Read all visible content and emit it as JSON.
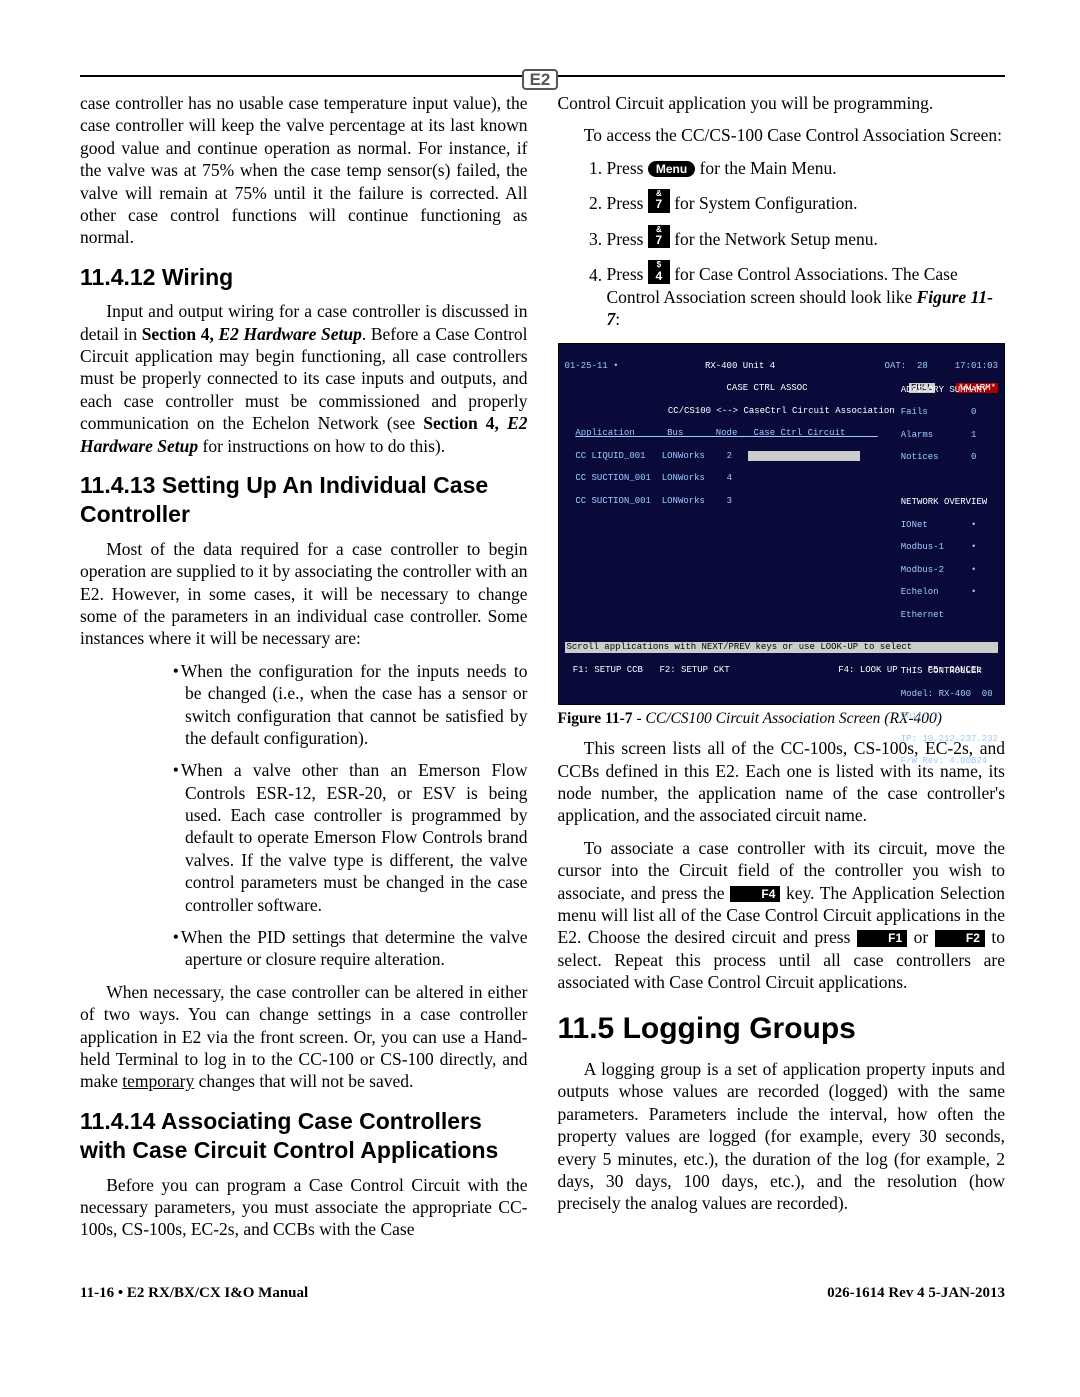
{
  "header_logo": "E2",
  "left": {
    "p1": "case controller has no usable case temperature input value), the case controller will keep the valve percentage at its last known good value and continue operation as normal. For instance, if the valve was at 75% when the case temp sensor(s) failed, the valve will remain at 75% until it the failure is corrected. All other case control functions will continue functioning as normal.",
    "h_wiring": "11.4.12 Wiring",
    "p_wiring_a": "Input and output wiring for a case controller is discussed in detail in ",
    "p_wiring_bold1": "Section 4, ",
    "p_wiring_ital1": "E2 Hardware Setup",
    "p_wiring_b": ". Before a Case Control Circuit application may begin functioning, all case controllers must be properly connected to its case inputs and outputs, and each case controller must be commissioned and properly communication on the Echelon Network (see ",
    "p_wiring_bold2": "Section 4, ",
    "p_wiring_ital2": "E2 Hardware Setup",
    "p_wiring_c": " for instructions on how to do this).",
    "h_setup": "11.4.13 Setting Up An Individual Case Controller",
    "p_setup": "Most of the data required for a case controller to begin operation are supplied to it by associating the controller with an E2. However, in some cases, it will be necessary to change some of the parameters in an individual case controller. Some instances where it will be necessary are:",
    "b1": "When the configuration for the inputs needs to be changed (i.e., when the case has a sensor or switch configuration that cannot be satisfied by the default configuration).",
    "b2": "When a valve other than an Emerson Flow Controls ESR-12, ESR-20, or ESV is being used. Each case controller is programmed by default to operate Emerson Flow Controls brand valves. If the valve type is different, the valve control parameters must be changed in the case controller software.",
    "b3": "When the PID settings that determine the valve aperture or closure require alteration.",
    "p_necessary_a": "When necessary, the case controller can be altered in either of two ways. You can change settings in a case controller application in E2 via the front screen. Or, you can use a Hand-held Terminal to log in to the CC-100 or CS-100 directly, and make ",
    "p_necessary_under": "temporary",
    "p_necessary_b": " changes that will not be saved.",
    "h_assoc": "11.4.14 Associating Case Controllers with Case Circuit Control Applications",
    "p_assoc": "Before you can program a Case Control Circuit with the necessary parameters, you must associate the appropriate CC-100s, CS-100s, EC-2s, and CCBs with the Case"
  },
  "right": {
    "p_cont": "Control Circuit application you will be programming.",
    "p_access": "To access the CC/CS-100 Case Control Association Screen:",
    "step1_a": "Press ",
    "step1_key": "Menu",
    "step1_b": " for the Main Menu.",
    "step2_a": "Press ",
    "step2_key_top": "&",
    "step2_key_bot": "7",
    "step2_b": " for System Configuration.",
    "step3_a": "Press ",
    "step3_key_top": "&",
    "step3_key_bot": "7",
    "step3_b": " for the Network Setup menu.",
    "step4_a": "Press ",
    "step4_key_top": "$",
    "step4_key_bot": "4",
    "step4_b": " for Case Control Associations. The Case Control Association screen should look like ",
    "step4_ref": "Figure 11-7",
    "step4_c": ":",
    "terminal": {
      "date": "01-25-11 • ",
      "title1": "RX-400 Unit 4",
      "oat": "OAT:  28",
      "time": "17:01:03",
      "title2": "CASE CTRL ASSOC",
      "full": "FULL",
      "alarm": "*ALARM*",
      "assoc_hdr": "CC/CS100 <--> CaseCtrl Circuit Association",
      "col_app": "Application",
      "col_bus": "Bus",
      "col_node": "Node",
      "col_ckt": "Case Ctrl Circuit",
      "r1a": "CC LIQUID_001",
      "r1b": "LONWorks",
      "r1c": "2",
      "r2a": "CC SUCTION_001",
      "r2b": "LONWorks",
      "r2c": "4",
      "r3a": "CC SUCTION_001",
      "r3b": "LONWorks",
      "r3c": "3",
      "adv": "ADVISORY SUMMARY",
      "fails": "Fails        0",
      "alarms": "Alarms       1",
      "notices": "Notices      0",
      "net": "NETWORK OVERVIEW",
      "n1": "IONet        •",
      "n2": "Modbus-1     •",
      "n3": "Modbus-2     •",
      "n4": "Echelon      •",
      "n5": "Ethernet     ",
      "ctrl": "THIS CONTROLLER",
      "c1": "Model: RX-400  00",
      "c2": "Unit: 4",
      "c3": "IP: 10.212.237.232",
      "c4": "F/W Rev: 4.00B24",
      "hint": "Scroll applications with NEXT/PREV keys or use LOOK-UP to select",
      "f1": "F1: SETUP CCB",
      "f2": "F2: SETUP CKT",
      "f4": "F4: LOOK UP",
      "f5": "F5: CANCEL"
    },
    "fig_label": "Figure 11-7",
    "fig_desc": " - CC/CS100 Circuit Association Screen (RX-400)",
    "p_screen": "This screen lists all of the CC-100s, CS-100s, EC-2s, and CCBs defined in this E2. Each one is listed with its name, its node number, the application name of the case controller's application, and the associated circuit name.",
    "p_assoc2_a": "To associate a case controller with its circuit, move the cursor into the Circuit field of the controller you wish to associate, and press the ",
    "k_f4": "F4",
    "p_assoc2_b": " key. The Application Selection menu will list all of the Case Control Circuit applications in the E2. Choose the desired circuit and press ",
    "k_f1": "F1",
    "p_assoc2_c": " or ",
    "k_f2": "F2",
    "p_assoc2_d": " to select. Repeat this process until all case controllers are associated with Case Control Circuit applications.",
    "h_logging": "11.5   Logging Groups",
    "p_logging": "A logging group is a set of application property inputs and outputs whose values are recorded (logged) with the same parameters. Parameters include the interval, how often the property values are logged (for example, every 30 seconds, every 5 minutes, etc.), the duration of the log (for example, 2 days, 30 days, 100 days, etc.), and the resolution (how precisely the analog values are recorded)."
  },
  "footer": {
    "left": "11-16 • E2 RX/BX/CX I&O Manual",
    "right": "026-1614 Rev 4 5-JAN-2013"
  }
}
